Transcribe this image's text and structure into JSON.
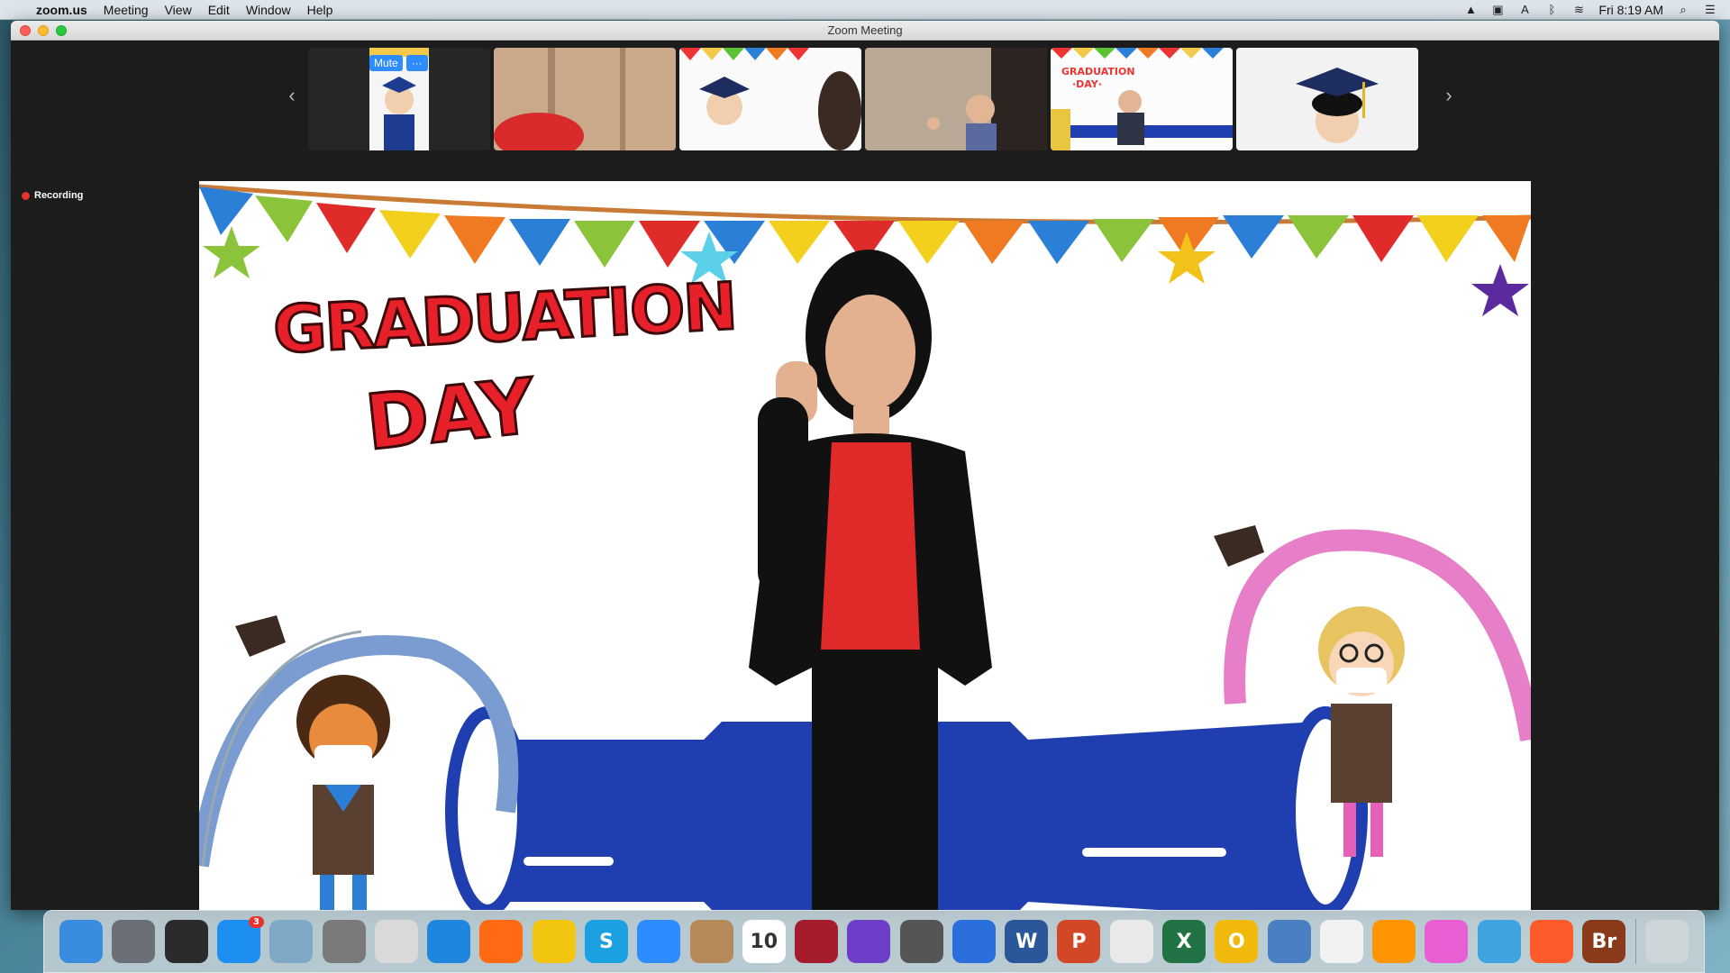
{
  "menubar": {
    "app_name": "zoom.us",
    "items": [
      "Meeting",
      "View",
      "Edit",
      "Window",
      "Help"
    ],
    "clock": "Fri 8:19 AM"
  },
  "window": {
    "title": "Zoom Meeting"
  },
  "filmstrip": {
    "mute_label": "Mute",
    "more_label": "···",
    "thumbnails": [
      "grad-boy-cap",
      "red-hat",
      "grad-girl",
      "boy-waving",
      "boy-grad-background",
      "girl-cap"
    ]
  },
  "recording": {
    "label": "Recording"
  },
  "stage": {
    "title": "GRADUATION",
    "subtitle": "DAY"
  },
  "dock": {
    "icons": [
      {
        "name": "finder-icon",
        "label": "",
        "color": "#3a8dde"
      },
      {
        "name": "launchpad-icon",
        "label": "",
        "color": "#6b6f78"
      },
      {
        "name": "activity-monitor-icon",
        "label": "",
        "color": "#2b2b2b"
      },
      {
        "name": "app-store-icon",
        "label": "",
        "color": "#1d8ef2",
        "badge": "3"
      },
      {
        "name": "preview-icon",
        "label": "",
        "color": "#7fa8c7"
      },
      {
        "name": "system-preferences-icon",
        "label": "",
        "color": "#7a7a7a"
      },
      {
        "name": "image-capture-icon",
        "label": "",
        "color": "#d9d9d9"
      },
      {
        "name": "safari-icon",
        "label": "",
        "color": "#1f86e0"
      },
      {
        "name": "firefox-icon",
        "label": "",
        "color": "#ff6a13"
      },
      {
        "name": "no-entry-icon",
        "label": "",
        "color": "#f2c511"
      },
      {
        "name": "skype-icon",
        "label": "S",
        "color": "#1ba1e2"
      },
      {
        "name": "zoom-icon",
        "label": "",
        "color": "#2d8cff"
      },
      {
        "name": "contacts-icon",
        "label": "",
        "color": "#b58a5a"
      },
      {
        "name": "calendar-icon",
        "label": "10",
        "color": "#ffffff"
      },
      {
        "name": "photo-booth-icon",
        "label": "",
        "color": "#a51d2d"
      },
      {
        "name": "imovie-icon",
        "label": "",
        "color": "#6d3fc9"
      },
      {
        "name": "script-editor-icon",
        "label": "",
        "color": "#555"
      },
      {
        "name": "keynote-icon",
        "label": "",
        "color": "#2a6fdb"
      },
      {
        "name": "word-icon",
        "label": "W",
        "color": "#2b579a"
      },
      {
        "name": "powerpoint-icon",
        "label": "P",
        "color": "#d24726"
      },
      {
        "name": "chrome-icon",
        "label": "",
        "color": "#e9e9e9"
      },
      {
        "name": "excel-icon",
        "label": "X",
        "color": "#217346"
      },
      {
        "name": "outlook-icon",
        "label": "O",
        "color": "#f0b90b"
      },
      {
        "name": "bluetooth-file-icon",
        "label": "",
        "color": "#4a7fc1"
      },
      {
        "name": "photos-icon",
        "label": "",
        "color": "#f2f2f2"
      },
      {
        "name": "books-icon",
        "label": "",
        "color": "#ff9500"
      },
      {
        "name": "itunes-icon",
        "label": "",
        "color": "#e85fd4"
      },
      {
        "name": "messenger-icon",
        "label": "",
        "color": "#3fa3e0"
      },
      {
        "name": "firefox2-icon",
        "label": "",
        "color": "#ff5a2a"
      },
      {
        "name": "bridge-icon",
        "label": "Br",
        "color": "#8a3a1a"
      },
      {
        "name": "trash-icon",
        "label": "",
        "color": "#cfd6da"
      }
    ]
  }
}
